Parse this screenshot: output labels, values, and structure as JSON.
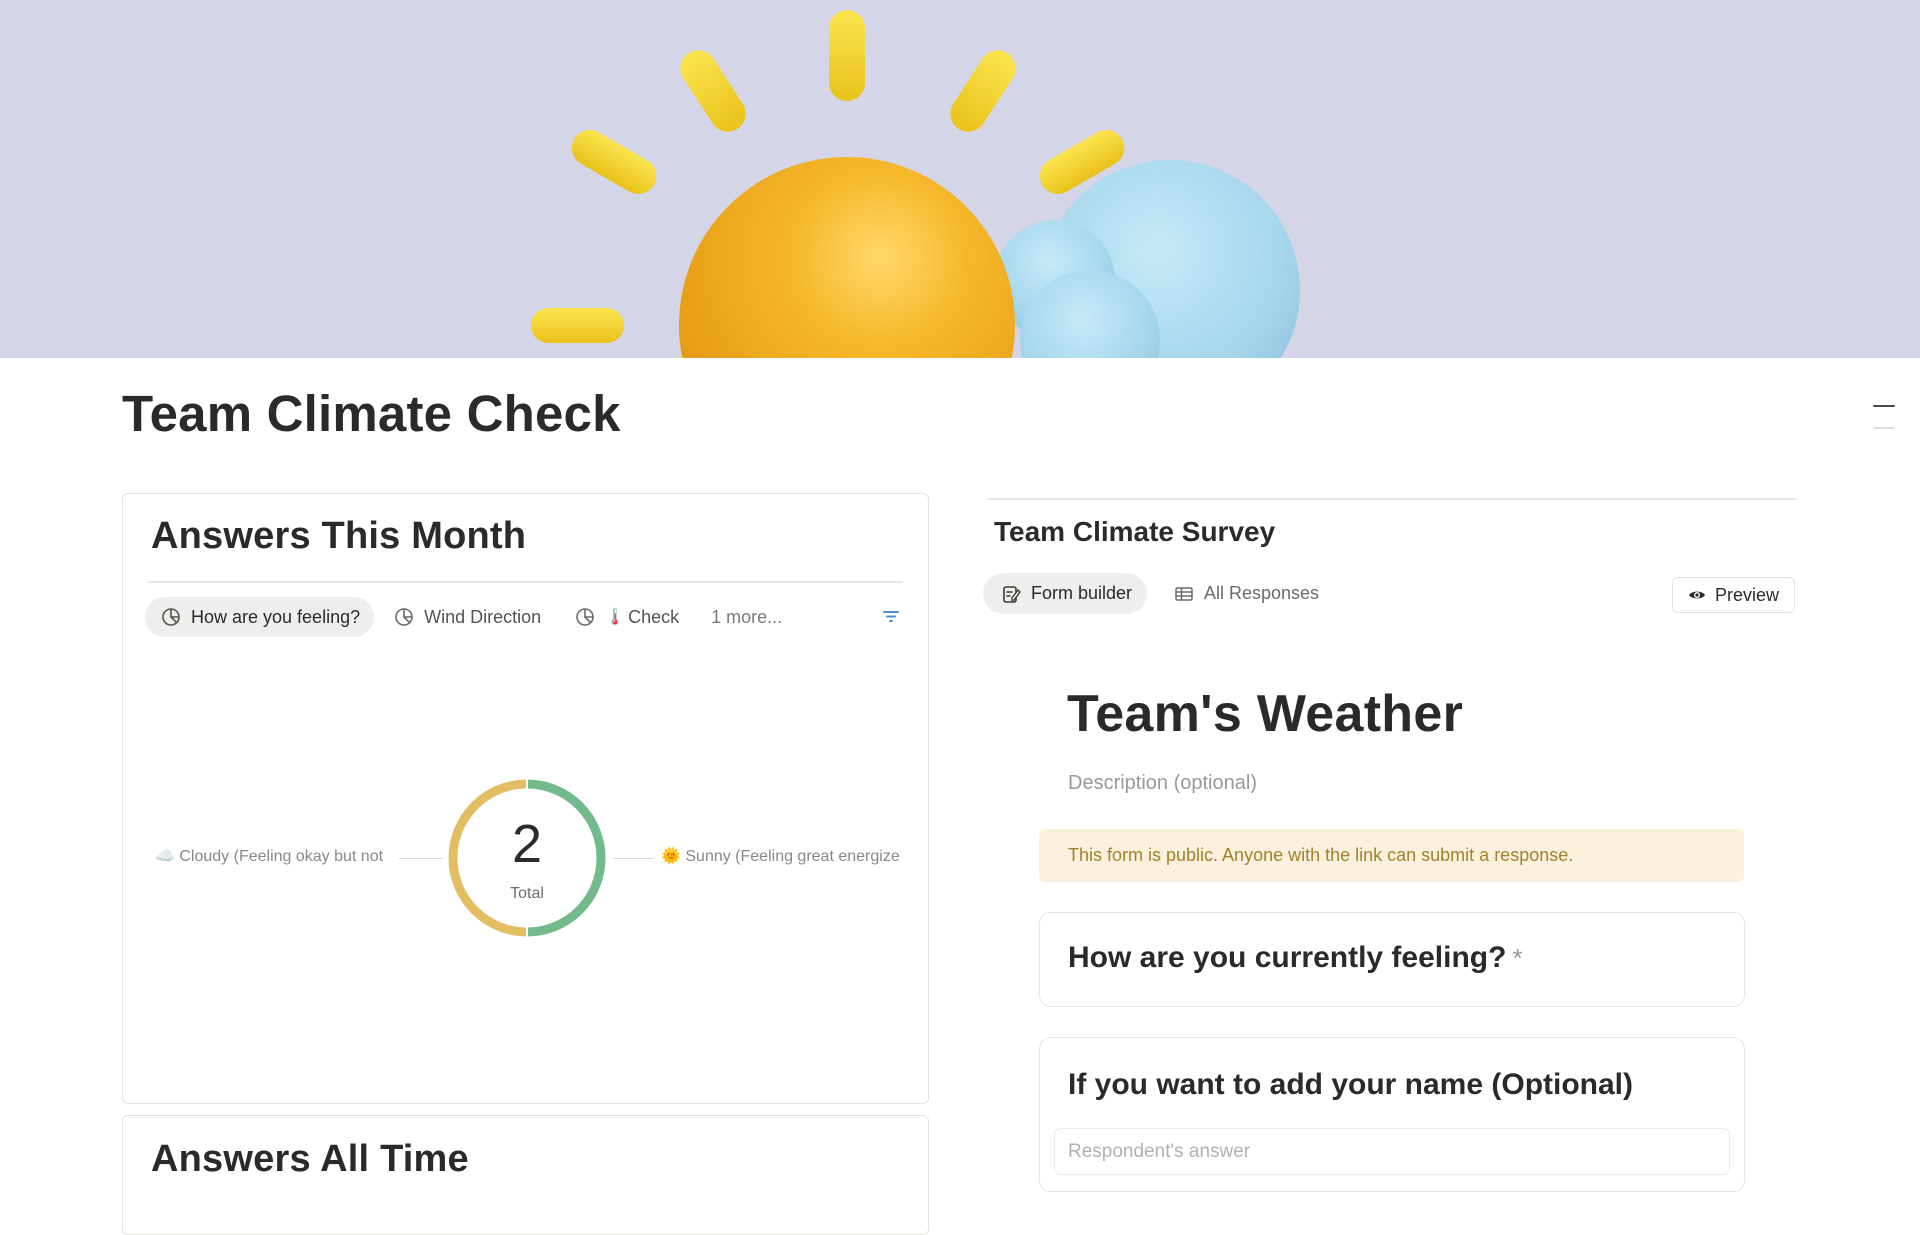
{
  "page": {
    "title": "Team Climate Check"
  },
  "cover": {
    "background": "#d5d5e8",
    "sun_color": "#f2ab1e",
    "cloud_color": "#a7d8ee",
    "ray_color": "#f5d62a"
  },
  "answers_month": {
    "title": "Answers This Month",
    "tabs": [
      {
        "label": "How are you feeling?",
        "icon": "pie-chart-icon",
        "active": true
      },
      {
        "label": "Wind Direction",
        "icon": "pie-chart-icon",
        "active": false
      },
      {
        "emoji": "🌡️",
        "label": "Check",
        "icon": "pie-chart-icon",
        "active": false
      }
    ],
    "more_label": "1 more...",
    "chart_data": {
      "type": "pie",
      "center_value": "2",
      "center_label": "Total",
      "categories": [
        "☁️ Cloudy (Feeling okay but not",
        "🌞 Sunny (Feeling great energize"
      ],
      "values": [
        1,
        1
      ],
      "colors": [
        "#e3bd62",
        "#72b98b"
      ]
    }
  },
  "answers_all_time": {
    "title": "Answers All Time"
  },
  "survey": {
    "title": "Team Climate Survey",
    "tabs": {
      "form_builder": "Form builder",
      "all_responses": "All Responses"
    },
    "preview_label": "Preview"
  },
  "form": {
    "title": "Team's Weather",
    "description_placeholder": "Description (optional)",
    "public_note": "This form is public. Anyone with the link can submit a response.",
    "questions": [
      {
        "title": "How are you currently feeling?",
        "required_mark": "*"
      },
      {
        "title": "If you want to add your name (Optional)",
        "answer_placeholder": "Respondent's answer"
      }
    ]
  }
}
